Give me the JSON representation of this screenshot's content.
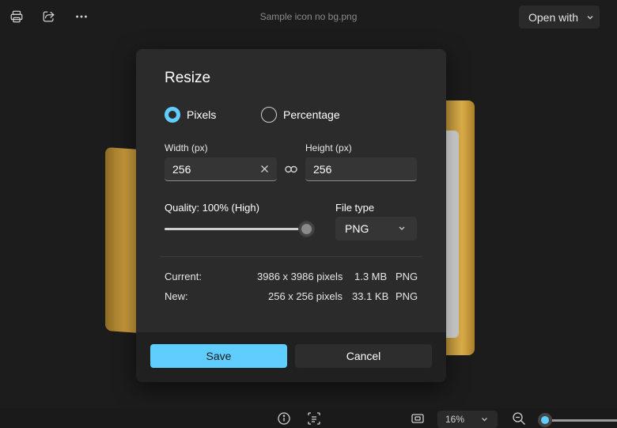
{
  "topbar": {
    "file_title": "Sample icon no bg.png",
    "open_with_label": "Open with",
    "icons": [
      "print-icon",
      "share-icon",
      "more-icon",
      "chevron-down-icon"
    ]
  },
  "dialog": {
    "title": "Resize",
    "radio_pixels": "Pixels",
    "radio_percentage": "Percentage",
    "selected_mode": "Pixels",
    "width_label": "Width  (px)",
    "width_value": "256",
    "height_label": "Height  (px)",
    "height_value": "256",
    "quality_label": "Quality: 100% (High)",
    "quality_percent": 100,
    "filetype_label": "File type",
    "filetype_value": "PNG",
    "current": {
      "label": "Current:",
      "dimensions": "3986 x 3986 pixels",
      "size": "1.3 MB",
      "type": "PNG"
    },
    "new": {
      "label": "New:",
      "dimensions": "256 x 256 pixels",
      "size": "33.1 KB",
      "type": "PNG"
    },
    "save_label": "Save",
    "cancel_label": "Cancel"
  },
  "bottombar": {
    "zoom_value": "16%",
    "zoom_level": 0.04,
    "icons": [
      "info-icon",
      "scan-text-icon",
      "actual-size-icon",
      "zoom-out-icon"
    ]
  },
  "colors": {
    "accent": "#60cdff",
    "background": "#1c1c1c",
    "dialog": "#2b2b2b"
  }
}
